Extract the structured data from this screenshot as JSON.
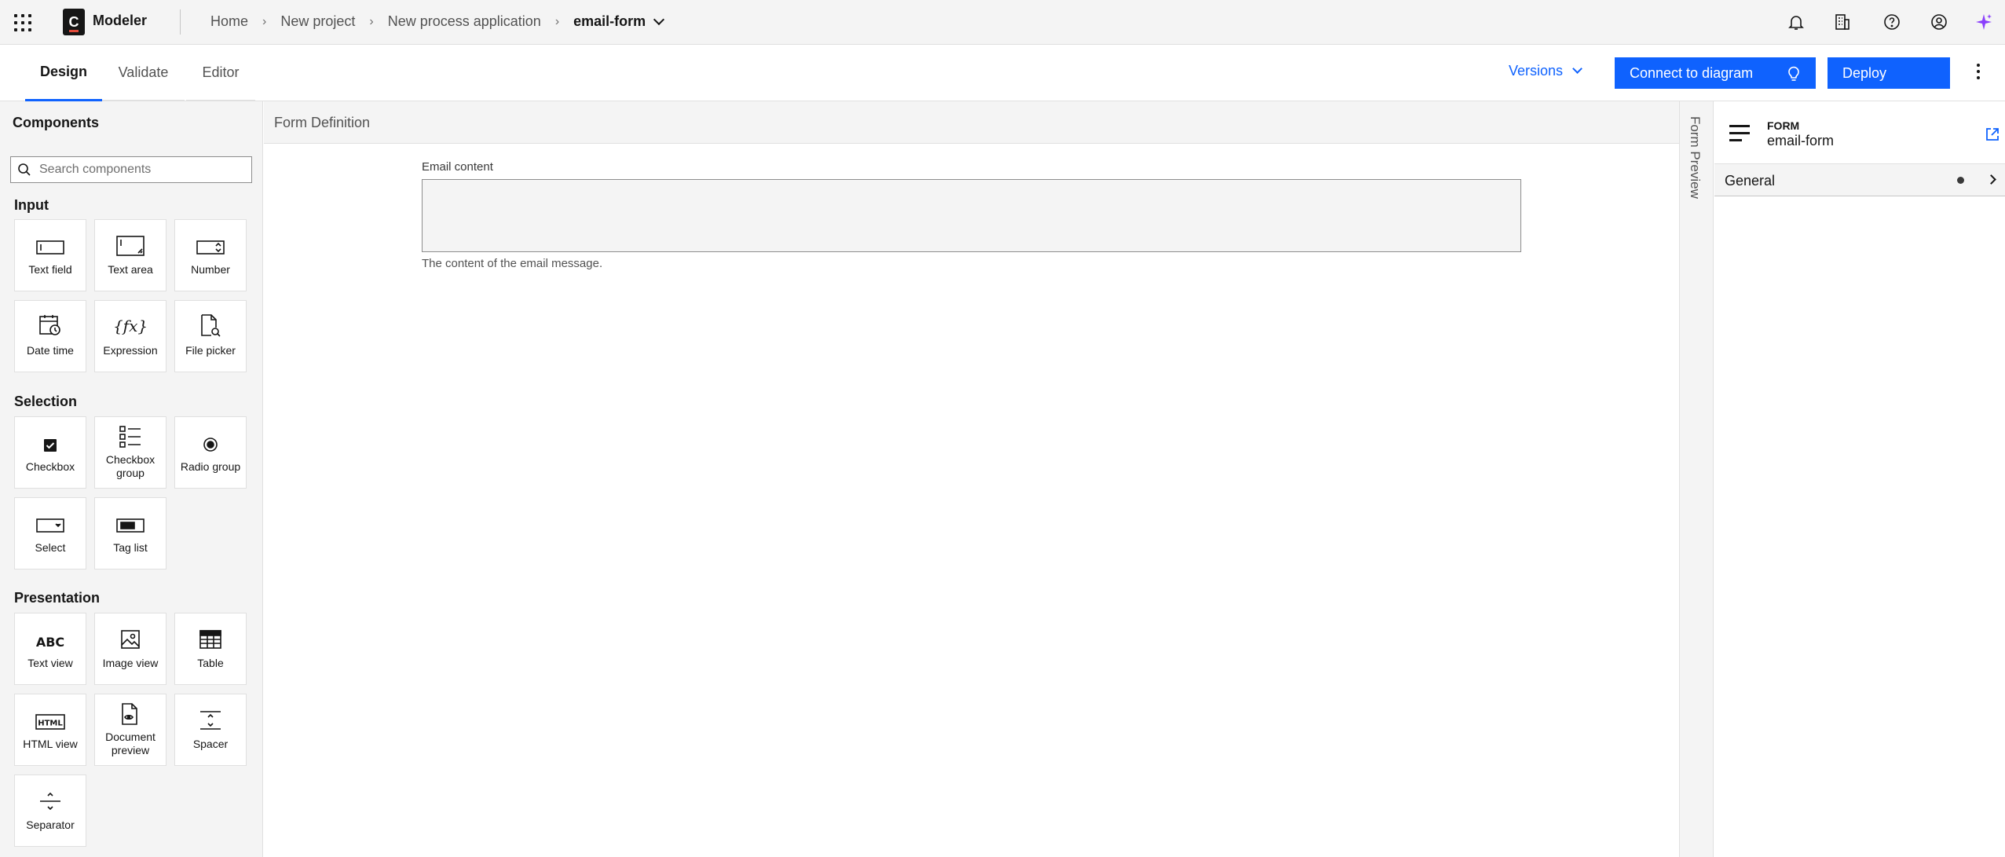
{
  "header": {
    "app_name": "Modeler",
    "logo_letter": "C",
    "breadcrumb": [
      "Home",
      "New project",
      "New process application"
    ],
    "breadcrumb_separator": "›",
    "current_file": "email-form",
    "icons": [
      "notification-icon",
      "organization-icon",
      "help-icon",
      "user-icon",
      "ai-sparkle-icon"
    ]
  },
  "tabs": [
    {
      "label": "Design",
      "active": true
    },
    {
      "label": "Validate",
      "active": false
    },
    {
      "label": "Editor",
      "active": false
    }
  ],
  "toolbar": {
    "versions_label": "Versions",
    "connect_label": "Connect to diagram",
    "deploy_label": "Deploy"
  },
  "components_panel": {
    "title": "Components",
    "search_placeholder": "Search components",
    "sections": [
      {
        "title": "Input",
        "items": [
          "Text field",
          "Text area",
          "Number",
          "Date time",
          "Expression",
          "File picker"
        ]
      },
      {
        "title": "Selection",
        "items": [
          "Checkbox",
          "Checkbox group",
          "Radio group",
          "Select",
          "Tag list"
        ]
      },
      {
        "title": "Presentation",
        "items": [
          "Text view",
          "Image view",
          "Table",
          "HTML view",
          "Document preview",
          "Spacer",
          "Separator"
        ]
      }
    ]
  },
  "canvas": {
    "title": "Form Definition",
    "field": {
      "label": "Email content",
      "value": "",
      "description": "The content of the email message."
    }
  },
  "preview": {
    "label": "Form Preview"
  },
  "properties": {
    "kind": "FORM",
    "name": "email-form",
    "groups": [
      {
        "label": "General"
      }
    ]
  },
  "colors": {
    "accent": "#0f62fe",
    "panel_bg": "#f4f4f4",
    "border": "#e0e0e0",
    "ai_accent": "#8a3ffc"
  }
}
